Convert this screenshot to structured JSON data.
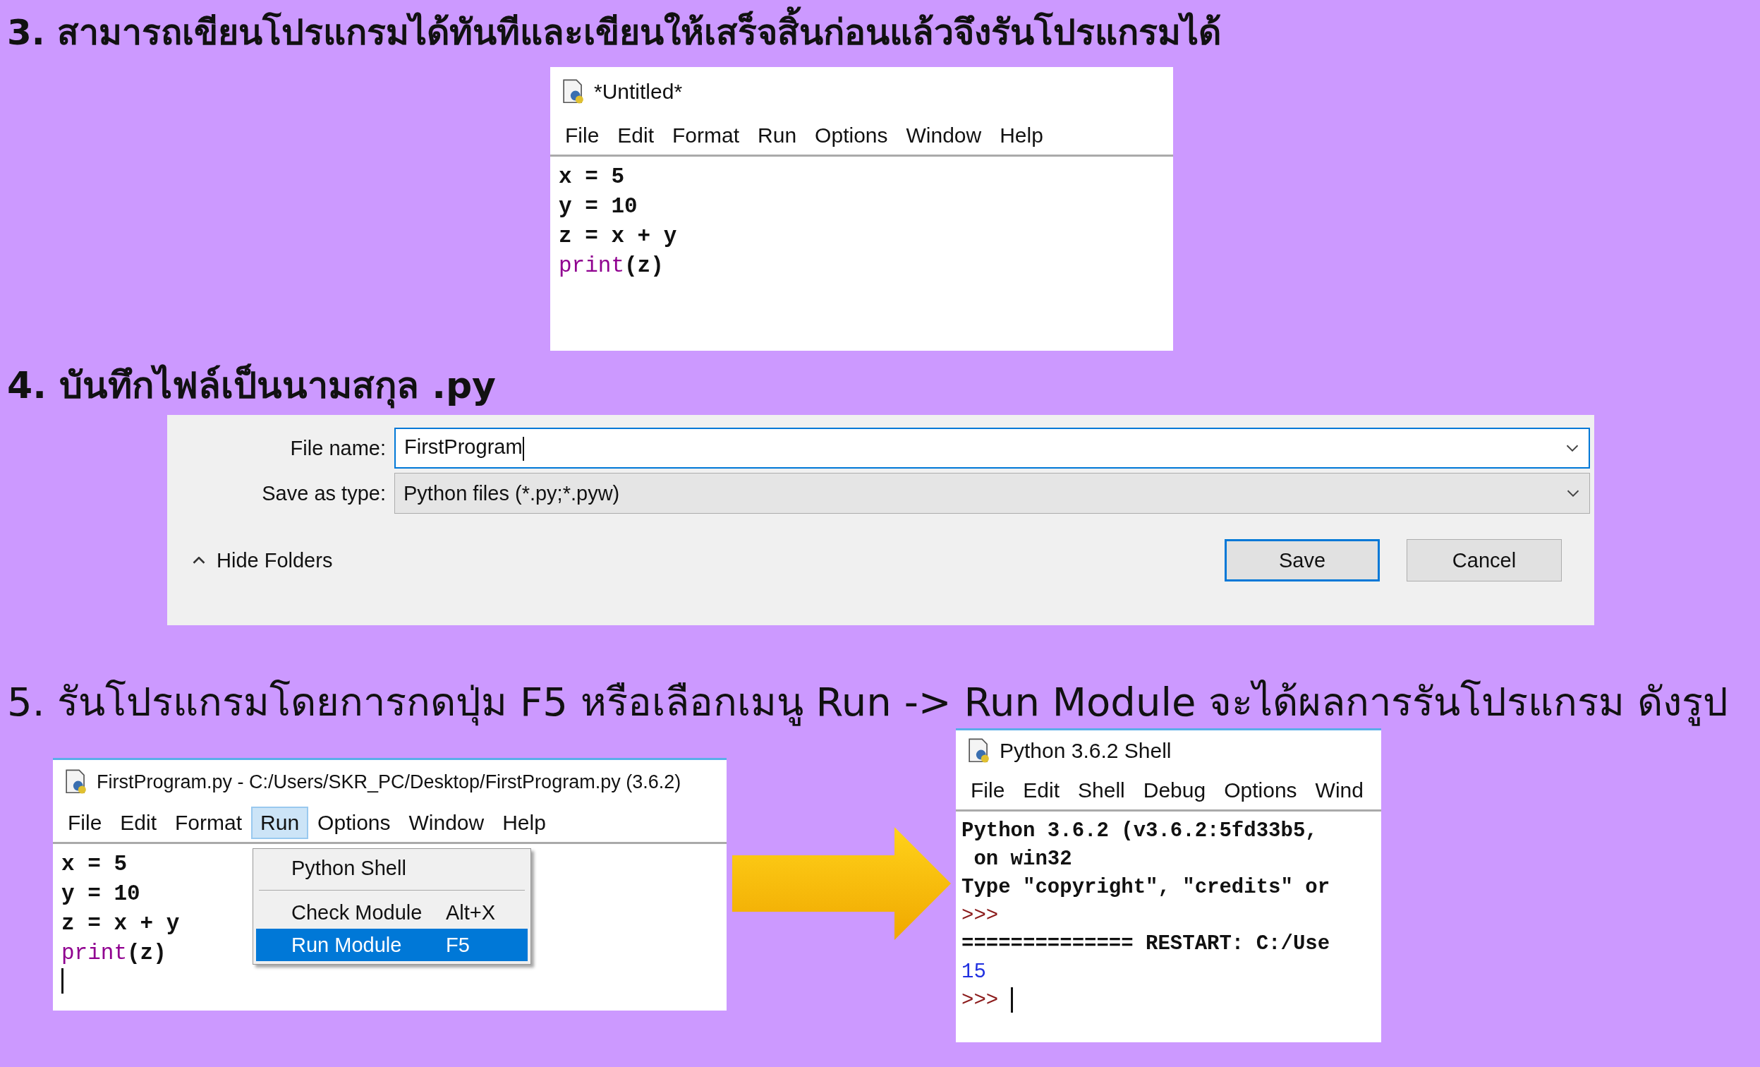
{
  "step_3": {
    "text": "3. สามารถเขียนโปรแกรมได้ทันทีและเขียนให้เสร็จสิ้นก่อนแล้วจึงรันโปรแกรมได้"
  },
  "editor_window": {
    "title": "*Untitled*",
    "menu": [
      {
        "label": "File",
        "selected": false
      },
      {
        "label": "Edit",
        "selected": false
      },
      {
        "label": "Format",
        "selected": false
      },
      {
        "label": "Run",
        "selected": false
      },
      {
        "label": "Options",
        "selected": false
      },
      {
        "label": "Window",
        "selected": false
      },
      {
        "label": "Help",
        "selected": false
      }
    ],
    "code": [
      [
        {
          "text": "x = 5",
          "kind": "plain"
        }
      ],
      [
        {
          "text": "y = 10",
          "kind": "plain"
        }
      ],
      [
        {
          "text": "z = x + y",
          "kind": "plain"
        }
      ],
      [
        {
          "text": "print",
          "kind": "builtin"
        },
        {
          "text": "(z)",
          "kind": "plain"
        }
      ]
    ]
  },
  "step_4": {
    "text": "4. บันทึกไฟล์เป็นนามสกุล .py"
  },
  "save_dialog": {
    "file_name_label": "File name:",
    "file_name": "FirstProgram",
    "type_label": "Save as type:",
    "type_value": "Python files (*.py;*.pyw)",
    "hide_folders": "Hide Folders",
    "buttons": [
      {
        "label": "Save",
        "default": true
      },
      {
        "label": "Cancel",
        "default": false
      }
    ]
  },
  "step_5": {
    "text": "5. รันโปรแกรมโดยการกดปุ่ม F5 หรือเลือกเมนู Run -> Run Module จะได้ผลการรันโปรแกรม ดังรูป"
  },
  "run_window": {
    "title": "FirstProgram.py - C:/Users/SKR_PC/Desktop/FirstProgram.py (3.6.2)",
    "menu": [
      {
        "label": "File",
        "selected": false
      },
      {
        "label": "Edit",
        "selected": false
      },
      {
        "label": "Format",
        "selected": false
      },
      {
        "label": "Run",
        "selected": true
      },
      {
        "label": "Options",
        "selected": false
      },
      {
        "label": "Window",
        "selected": false
      },
      {
        "label": "Help",
        "selected": false
      }
    ],
    "code": [
      [
        {
          "text": "x = 5",
          "kind": "plain"
        }
      ],
      [
        {
          "text": "y = 10",
          "kind": "plain"
        }
      ],
      [
        {
          "text": "z = x + y",
          "kind": "plain"
        }
      ],
      [
        {
          "text": "print",
          "kind": "builtin"
        },
        {
          "text": "(z)",
          "kind": "plain"
        }
      ]
    ],
    "cursor": true,
    "run_menu": [
      {
        "label": "Python Shell",
        "selected": false,
        "separator_after": true
      },
      {
        "label": "Check Module",
        "shortcut": "Alt+X",
        "selected": false,
        "separator_after": false
      },
      {
        "label": "Run Module",
        "shortcut": "F5",
        "selected": true,
        "separator_after": false
      }
    ]
  },
  "shell_window": {
    "title": "Python 3.6.2 Shell",
    "menu": [
      {
        "label": "File",
        "selected": false
      },
      {
        "label": "Edit",
        "selected": false
      },
      {
        "label": "Shell",
        "selected": false
      },
      {
        "label": "Debug",
        "selected": false
      },
      {
        "label": "Options",
        "selected": false
      },
      {
        "label": "Wind",
        "selected": false
      }
    ],
    "output": [
      [
        {
          "text": "Python 3.6.2 (v3.6.2:5fd33b5,",
          "kind": "plain"
        }
      ],
      [
        {
          "text": " on win32",
          "kind": "plain"
        }
      ],
      [
        {
          "text": "Type \"copyright\", \"credits\" or",
          "kind": "plain"
        }
      ],
      [
        {
          "text": ">>>",
          "kind": "prompt"
        }
      ],
      [
        {
          "text": "============== RESTART: C:/Use",
          "kind": "plain"
        }
      ],
      [
        {
          "text": "15",
          "kind": "result"
        }
      ],
      [
        {
          "text": ">>>",
          "kind": "prompt"
        }
      ]
    ],
    "cursor": true
  }
}
